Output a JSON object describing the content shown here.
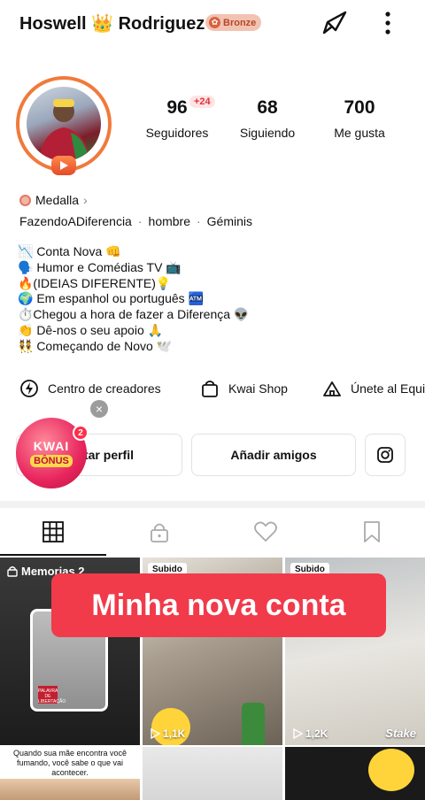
{
  "header": {
    "name_first": "Hoswell",
    "crown_emoji": "👑",
    "name_last": "Rodriguez",
    "badge_label": "Bronze",
    "colors": {
      "brand": "#f13a4a",
      "bronze": "#d9623f"
    }
  },
  "stats": [
    {
      "value": "96",
      "label": "Seguidores",
      "new_badge": "+24"
    },
    {
      "value": "68",
      "label": "Siguiendo"
    },
    {
      "value": "700",
      "label": "Me gusta"
    }
  ],
  "medal": {
    "label": "Medalla",
    "chevron": "›"
  },
  "tags": [
    "FazendoADiferencia",
    "hombre",
    "Géminis"
  ],
  "tag_separator": "·",
  "bio": [
    "📉 Conta Nova 👊",
    "🗣️ Humor e Comédias TV 📺",
    "🔥(IDEIAS DIFERENTE)💡",
    "🌍 Em espanhol ou português 🏧",
    "⏱️Chegou a hora de fazer a Diferença 👽",
    "👏 Dê-nos o seu apoio 🙏",
    "👯 Começando de Novo 🕊️"
  ],
  "quick_links": [
    {
      "label": "Centro de creadores",
      "icon": "bolt-circle-icon"
    },
    {
      "label": "Kwai Shop",
      "icon": "shopping-bag-icon"
    },
    {
      "label": "Únete al Equi",
      "icon": "guild-tent-icon"
    }
  ],
  "buttons": {
    "edit_profile": "tar perfil",
    "add_friends": "Añadir amigos",
    "instagram_icon": "instagram-icon"
  },
  "kwai_bonus": {
    "line1": "KWAI",
    "line2": "BÔNUS",
    "count": "2",
    "close": "×"
  },
  "tabs": [
    {
      "name": "grid",
      "icon": "grid-icon",
      "active": true
    },
    {
      "name": "private",
      "icon": "lock-icon"
    },
    {
      "name": "liked",
      "icon": "heart-icon"
    },
    {
      "name": "saved",
      "icon": "bookmark-icon"
    }
  ],
  "grid": {
    "overlay_banner": "Minha nova conta",
    "memories_label": "Memorias 2",
    "memories_thumb_label": "PALAVRA DE LIBERTAÇÃO",
    "items": [
      {
        "label": "Subido",
        "views": "1,1K"
      },
      {
        "label": "Subido",
        "views": "1,2K",
        "watermark": "Stake"
      }
    ],
    "caption_row3": "Quando sua mãe encontra você fumando, você sabe o que vai acontecer."
  }
}
